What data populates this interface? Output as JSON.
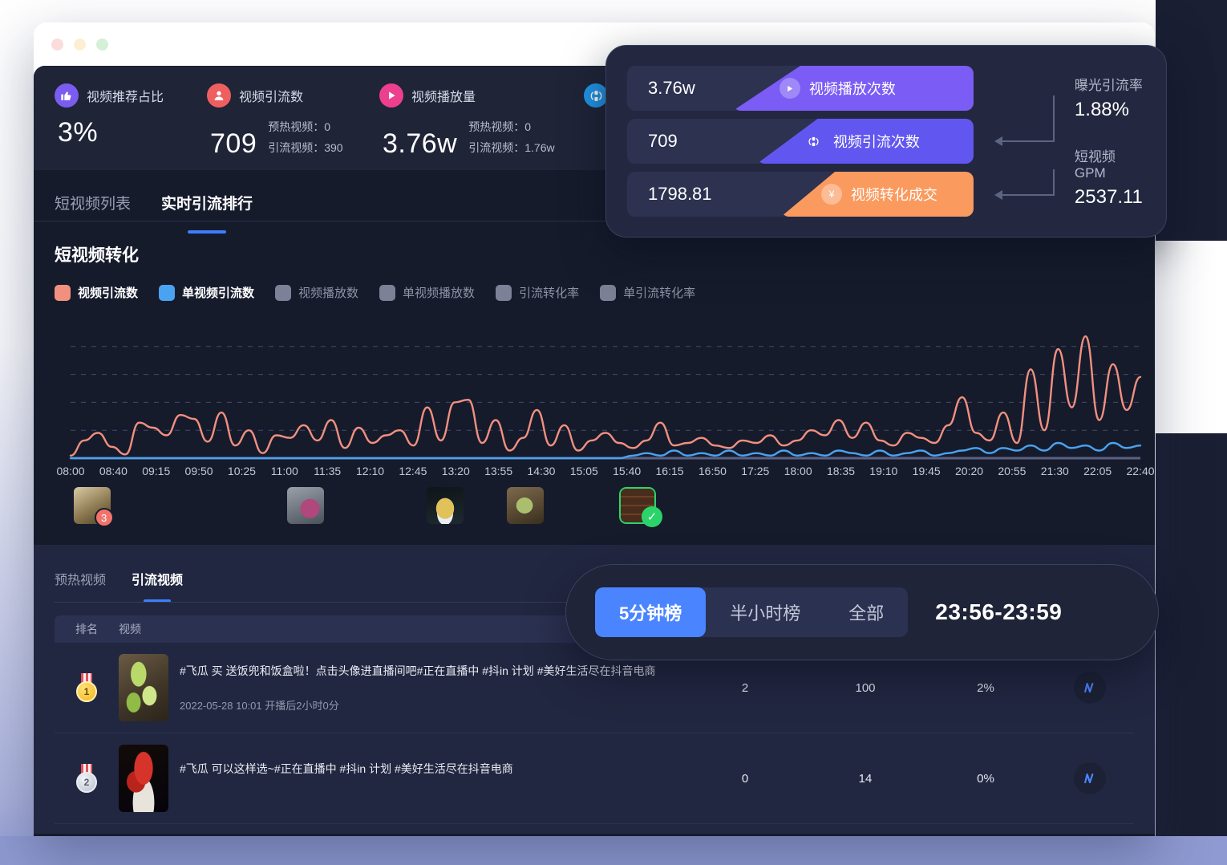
{
  "window": {
    "dots": [
      "red",
      "yellow",
      "green"
    ]
  },
  "kpis": [
    {
      "icon": "thumbs-up-icon",
      "icon_color": "#7a5cf0",
      "title": "视频推荐占比",
      "value": "3%",
      "sub": []
    },
    {
      "icon": "user-icon",
      "icon_color": "#ef5f5f",
      "title": "视频引流数",
      "value": "709",
      "sub": [
        {
          "label": "预热视频：",
          "value": "0"
        },
        {
          "label": "引流视频：",
          "value": "390"
        }
      ]
    },
    {
      "icon": "play-icon",
      "icon_color": "#ec3f8e",
      "title": "视频播放量",
      "value": "3.76w",
      "sub": [
        {
          "label": "预热视频：",
          "value": "0"
        },
        {
          "label": "引流视频：",
          "value": "1.76w"
        }
      ]
    },
    {
      "icon": "conversion-icon",
      "icon_color": "#2196e8",
      "title": "",
      "value": "",
      "sub": []
    }
  ],
  "tabs": [
    {
      "label": "短视频列表",
      "active": false
    },
    {
      "label": "实时引流排行",
      "active": true
    }
  ],
  "chart_panel": {
    "title": "短视频转化"
  },
  "chart_data": {
    "type": "line",
    "title": "短视频转化",
    "xlabel": "",
    "ylabel": "",
    "grid": true,
    "legend_position": "top",
    "x": [
      "08:00",
      "08:40",
      "09:15",
      "09:50",
      "10:25",
      "11:00",
      "11:35",
      "12:10",
      "12:45",
      "13:20",
      "13:55",
      "14:30",
      "15:05",
      "15:40",
      "16:15",
      "16:50",
      "17:25",
      "18:00",
      "18:35",
      "19:10",
      "19:45",
      "20:20",
      "20:55",
      "21:30",
      "22:05",
      "22:40"
    ],
    "series": [
      {
        "name": "视频引流数",
        "color": "#f2907f",
        "visible": true,
        "values": [
          2,
          14,
          20,
          9,
          3,
          28,
          24,
          18,
          34,
          31,
          13,
          36,
          10,
          22,
          4,
          18,
          16,
          26,
          14,
          30,
          8,
          24,
          12,
          18,
          22,
          10,
          40,
          14,
          44,
          46,
          12,
          30,
          6,
          16,
          38,
          10,
          26,
          6,
          14,
          20,
          12,
          8,
          14,
          28,
          10,
          12,
          16,
          10,
          8,
          14,
          12,
          18,
          10,
          14,
          22,
          18,
          30,
          16,
          28,
          14,
          10,
          20,
          16,
          12,
          26,
          48,
          20,
          14,
          36,
          12,
          70,
          22,
          86,
          40,
          96,
          30,
          74,
          38,
          64
        ]
      },
      {
        "name": "单视频引流数",
        "color": "#4aa3f0",
        "visible": true,
        "values": [
          0,
          0,
          0,
          0,
          0,
          0,
          0,
          0,
          0,
          0,
          0,
          0,
          0,
          0,
          0,
          0,
          0,
          0,
          0,
          0,
          0,
          0,
          0,
          0,
          0,
          0,
          0,
          0,
          0,
          0,
          0,
          0,
          0,
          0,
          0,
          0,
          0,
          0,
          0,
          0,
          0,
          2,
          4,
          2,
          6,
          2,
          4,
          2,
          6,
          2,
          4,
          2,
          6,
          2,
          4,
          2,
          6,
          4,
          2,
          6,
          2,
          4,
          6,
          2,
          4,
          6,
          8,
          4,
          8,
          6,
          10,
          6,
          12,
          8,
          10,
          6,
          12,
          8,
          10
        ]
      },
      {
        "name": "视频播放数",
        "color": "#7b8196",
        "visible": false,
        "values": []
      },
      {
        "name": "单视频播放数",
        "color": "#7b8196",
        "visible": false,
        "values": []
      },
      {
        "name": "引流转化率",
        "color": "#7b8196",
        "visible": false,
        "values": []
      },
      {
        "name": "单引流转化率",
        "color": "#7b8196",
        "visible": false,
        "values": []
      }
    ],
    "ylim": [
      0,
      110
    ],
    "gridlines": 4
  },
  "timeline_markers": [
    {
      "position_pct": 2.0,
      "badge": "3",
      "badge_type": "count",
      "selected": false,
      "art": "food-bread"
    },
    {
      "position_pct": 22.0,
      "badge": "",
      "badge_type": "none",
      "selected": false,
      "art": "food-fruit"
    },
    {
      "position_pct": 35.0,
      "badge": "",
      "badge_type": "none",
      "selected": false,
      "art": "food-noodle"
    },
    {
      "position_pct": 42.5,
      "badge": "",
      "badge_type": "none",
      "selected": false,
      "art": "food-veg"
    },
    {
      "position_pct": 53.0,
      "badge": "✓",
      "badge_type": "check",
      "selected": true,
      "art": "food-choco"
    }
  ],
  "list_panel": {
    "subtabs": [
      {
        "label": "预热视频",
        "active": false
      },
      {
        "label": "引流视频",
        "active": true
      }
    ],
    "headers": {
      "rank": "排名",
      "video": "视频"
    },
    "rows": [
      {
        "rank": "1",
        "medal": "gold",
        "title": "#飞瓜 买 送饭兜和饭盒啦！点击头像进直播间吧#正在直播中 #抖in 计划 #美好生活尽在抖音电商",
        "meta": "2022-05-28 10:01 开播后2小时0分",
        "col1": "2",
        "col2": "100",
        "col3": "2%",
        "action_icon": "trend-icon",
        "art": "food-melon"
      },
      {
        "rank": "2",
        "medal": "silver",
        "title": "#飞瓜 可以这样选~#正在直播中 #抖in 计划 #美好生活尽在抖音电商",
        "meta": "",
        "col1": "0",
        "col2": "14",
        "col3": "0%",
        "action_icon": "trend-icon",
        "art": "food-chili"
      }
    ]
  },
  "funnel": {
    "rows": [
      {
        "value": "3.76w",
        "label": "视频播放次数",
        "icon": "play-icon",
        "color": "#7b5cf5",
        "tag_width": 300
      },
      {
        "value": "709",
        "label": "视频引流次数",
        "icon": "conversion-icon",
        "color": "#6157f0",
        "tag_width": 270
      },
      {
        "value": "1798.81",
        "label": "视频转化成交",
        "icon": "yuan-icon",
        "color": "#fb9a5e",
        "tag_width": 240
      }
    ],
    "metrics": [
      {
        "label": "曝光引流率",
        "value": "1.88%"
      },
      {
        "label": "短视频GPM",
        "value": "2537.11"
      }
    ]
  },
  "pill": {
    "options": [
      {
        "label": "5分钟榜",
        "active": true
      },
      {
        "label": "半小时榜",
        "active": false
      },
      {
        "label": "全部",
        "active": false
      }
    ],
    "time_range": "23:56-23:59"
  }
}
